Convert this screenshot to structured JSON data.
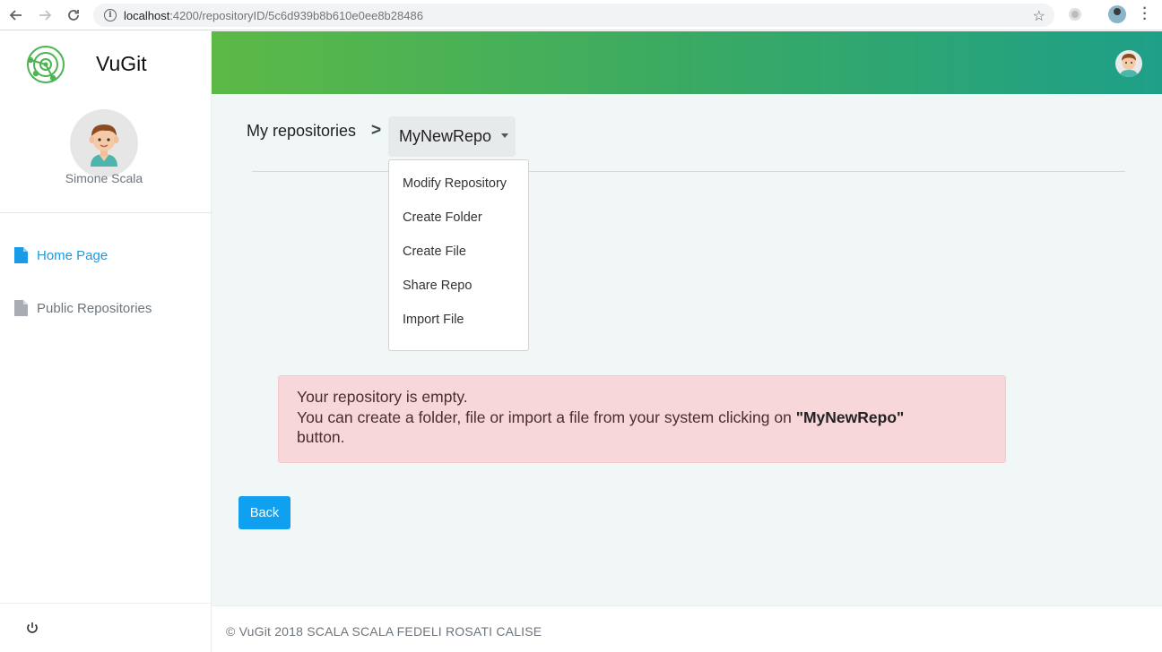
{
  "browser": {
    "url_host": "localhost",
    "url_path": ":4200/repositoryID/5c6d939b8b610e0ee8b28486"
  },
  "sidebar": {
    "brand": "VuGit",
    "user_name": "Simone Scala",
    "items": [
      {
        "label": "Home Page",
        "active": true,
        "icon": "document-icon"
      },
      {
        "label": "Public Repositories",
        "active": false,
        "icon": "document-icon"
      }
    ]
  },
  "breadcrumb": {
    "root": "My repositories",
    "separator": ">",
    "current": "MyNewRepo"
  },
  "dropdown": {
    "items": [
      "Modify Repository",
      "Create Folder",
      "Create File",
      "Share Repo",
      "Import File"
    ]
  },
  "alert": {
    "line1": "Your repository is empty.",
    "line2_prefix": "You can create a folder, file or import a file from your system clicking on ",
    "line2_bold": "\"MyNewRepo\"",
    "line3": "button."
  },
  "back_button": "Back",
  "footer": "© VuGit 2018 SCALA SCALA FEDELI ROSATI CALISE",
  "colors": {
    "accent": "#1a9be6",
    "button": "#0fa0f0",
    "alert_bg": "#f8d7da",
    "banner_start": "#5cb946",
    "banner_end": "#1ea088"
  }
}
